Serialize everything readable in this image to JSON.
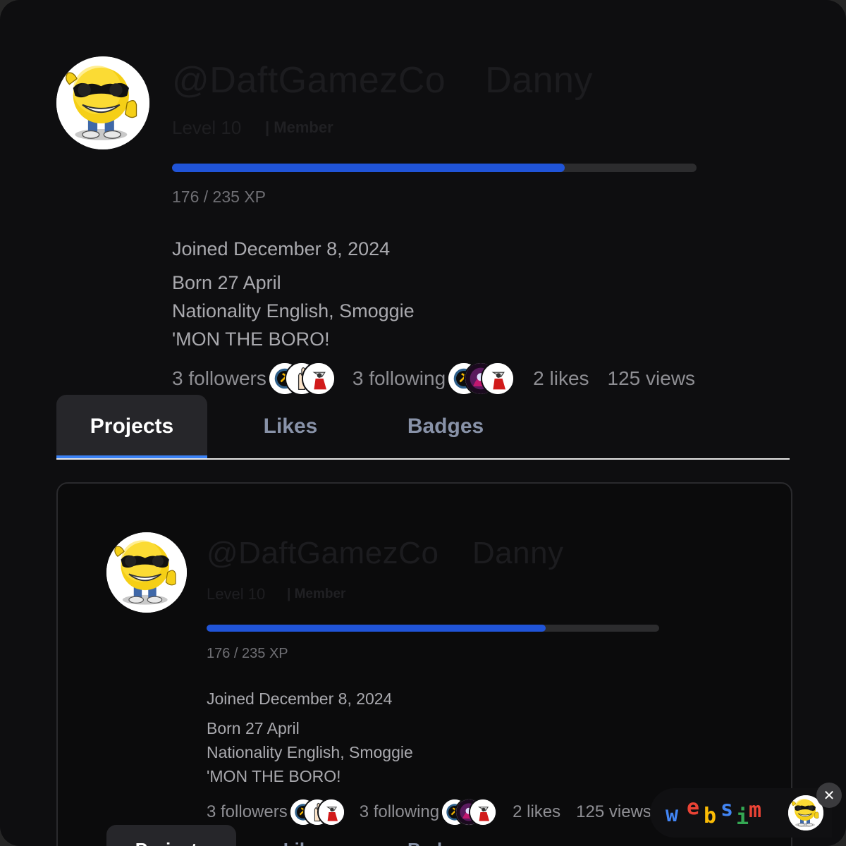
{
  "profile": {
    "username": "@DaftGamezCo",
    "display_name": "Danny",
    "level": "Level 10",
    "role": "| Member",
    "xp_text": "176 / 235 XP",
    "xp_progress": 0.749,
    "joined": "Joined December 8, 2024",
    "bio": [
      "Born 27 April",
      "Nationality English, Smoggie",
      "'MON THE BORO!"
    ],
    "followers": "3 followers",
    "following": "3 following",
    "likes": "2 likes",
    "views": "125 views",
    "avatar_icon": "cool-smiley-sunglasses-thumbs-up-icon"
  },
  "tabs": [
    {
      "label": "Projects",
      "active": true
    },
    {
      "label": "Likes",
      "active": false
    },
    {
      "label": "Badges",
      "active": false
    }
  ],
  "embedded_tabs": [
    "Projects",
    "Likes",
    "Badges"
  ],
  "websim_badge": {
    "letters": [
      "w",
      "e",
      "b",
      "s",
      "i",
      "m"
    ],
    "colors": [
      "#4285f4",
      "#ea4335",
      "#fbbc05",
      "#4285f4",
      "#34a853",
      "#ea4335"
    ],
    "close_label": "✕"
  },
  "colors": {
    "background": "#0e0e10",
    "accent": "#2054d8",
    "tab_underline": "#3b82f6"
  }
}
